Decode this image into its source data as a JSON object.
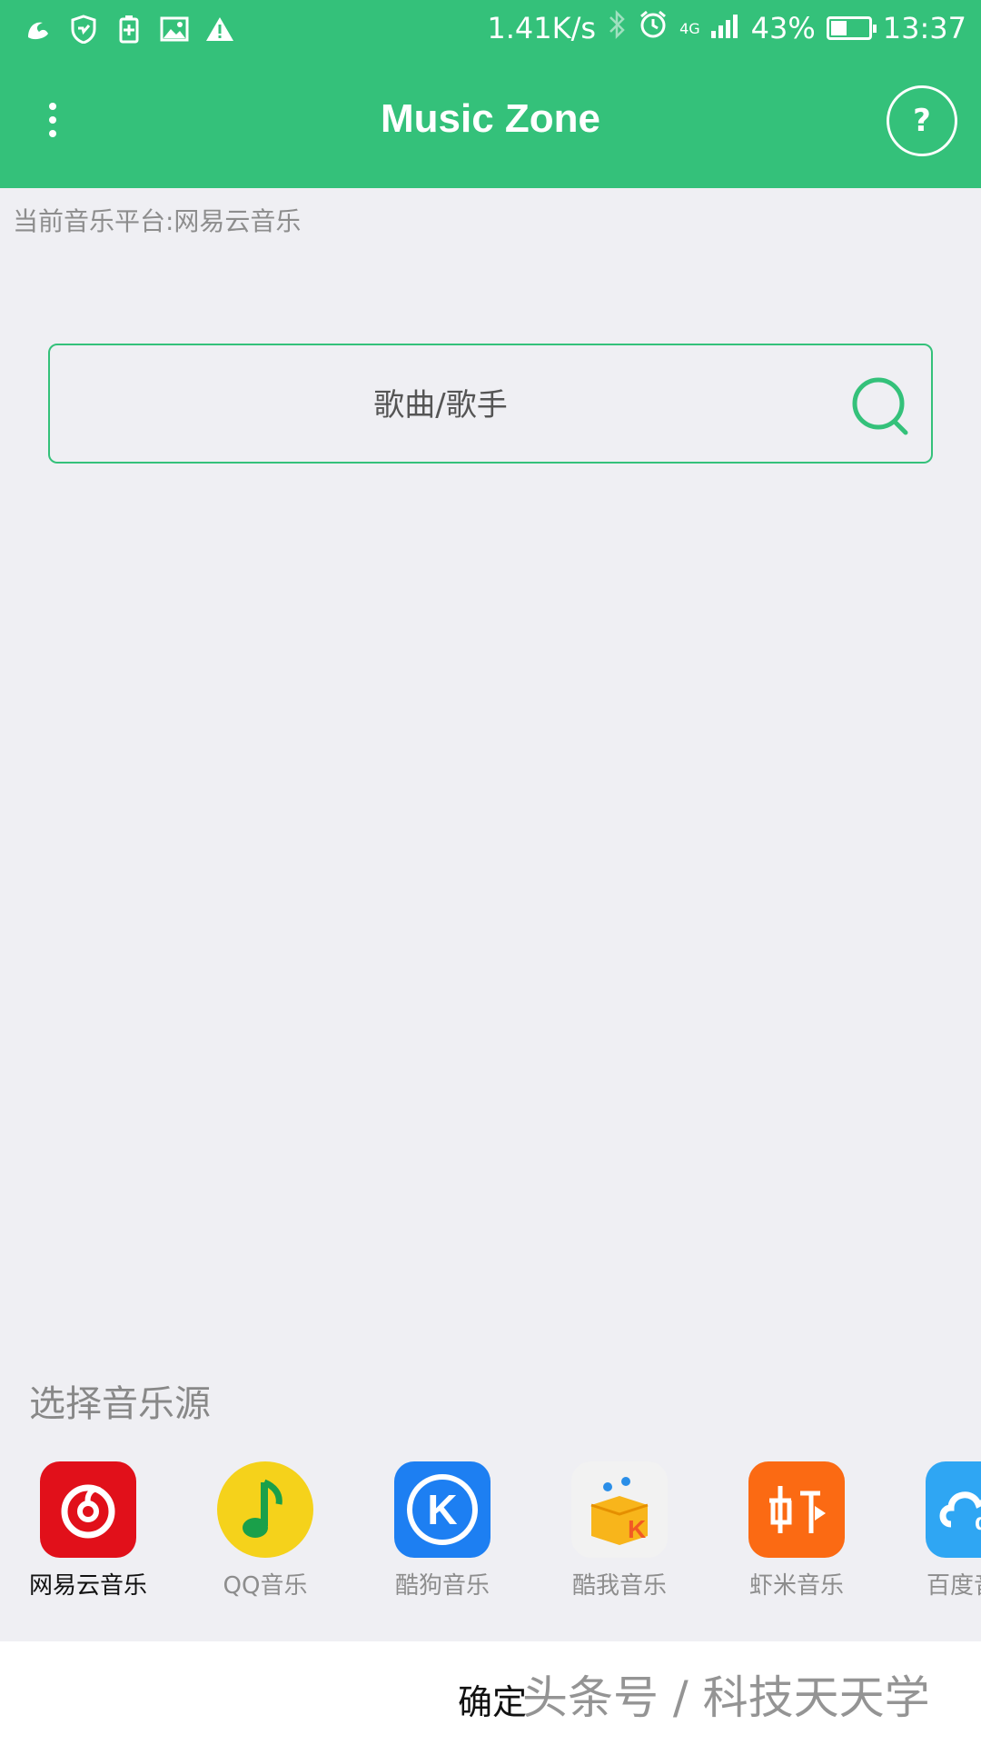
{
  "status_bar": {
    "net_speed": "1.41K/s",
    "network": "4G",
    "battery": "43%",
    "battery_level": 0.43,
    "time": "13:37"
  },
  "app_bar": {
    "title": "Music Zone",
    "help_label": "?"
  },
  "platform_label": "当前音乐平台:网易云音乐",
  "search": {
    "placeholder": "歌曲/歌手"
  },
  "source_picker": {
    "title": "选择音乐源",
    "items": [
      {
        "label": "网易云音乐",
        "selected": true
      },
      {
        "label": "QQ音乐",
        "selected": false
      },
      {
        "label": "酷狗音乐",
        "selected": false
      },
      {
        "label": "酷我音乐",
        "selected": false
      },
      {
        "label": "虾米音乐",
        "selected": false
      },
      {
        "label": "百度音乐",
        "selected": false
      }
    ]
  },
  "footer": {
    "confirm_label": "确定",
    "watermark": "头条号 / 科技天天学"
  },
  "colors": {
    "accent": "#34c17a",
    "netease": "#e1101a",
    "qq": "#f5d21b",
    "kugou": "#1d7ff2",
    "xiami": "#fb6a13",
    "baidu": "#2fa6f3"
  }
}
